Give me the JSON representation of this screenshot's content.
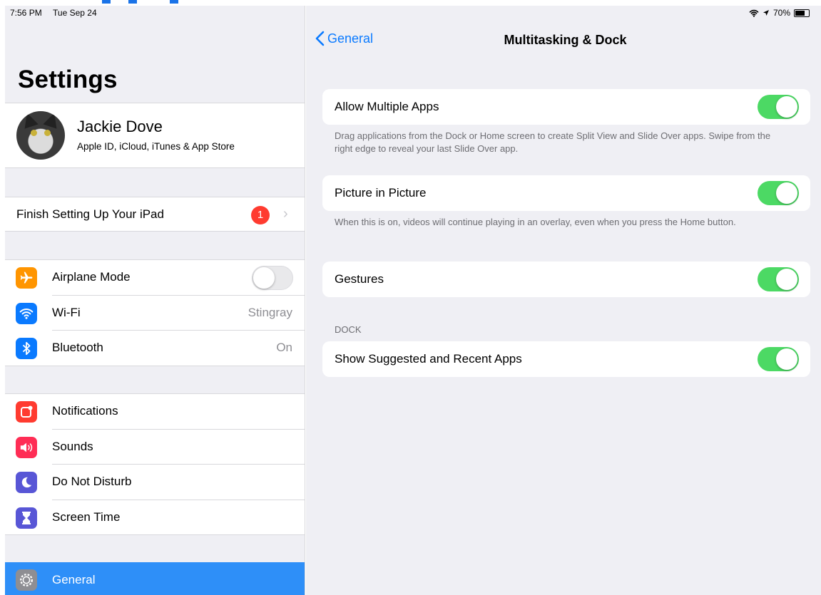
{
  "status": {
    "time": "7:56 PM",
    "date": "Tue Sep 24",
    "battery": "70%"
  },
  "master": {
    "title": "Settings",
    "profile": {
      "name": "Jackie Dove",
      "subtitle": "Apple ID, iCloud, iTunes & App Store"
    },
    "finish": {
      "label": "Finish Setting Up Your iPad",
      "badge": "1"
    },
    "connectivity": [
      {
        "label": "Airplane Mode",
        "icon": "airplane-icon",
        "color": "#ff9500",
        "toggle": false
      },
      {
        "label": "Wi-Fi",
        "icon": "wifi-icon",
        "color": "#0a7aff",
        "value": "Stingray"
      },
      {
        "label": "Bluetooth",
        "icon": "bluetooth-icon",
        "color": "#0a7aff",
        "value": "On"
      }
    ],
    "notifications_group": [
      {
        "label": "Notifications",
        "icon": "notifications-icon",
        "color": "#ff3b30"
      },
      {
        "label": "Sounds",
        "icon": "speaker-icon",
        "color": "#ff2d55"
      },
      {
        "label": "Do Not Disturb",
        "icon": "moon-icon",
        "color": "#5856d6"
      },
      {
        "label": "Screen Time",
        "icon": "hourglass-icon",
        "color": "#5856d6"
      }
    ],
    "general": {
      "label": "General",
      "icon": "gear-icon",
      "selected": true,
      "selection_color": "#2e8ff8"
    }
  },
  "detail": {
    "back_label": "General",
    "title": "Multitasking & Dock",
    "allow_multiple_apps": {
      "label": "Allow Multiple Apps",
      "on": true,
      "footnote": "Drag applications from the Dock or Home screen to create Split View and Slide Over apps. Swipe from the right edge to reveal your last Slide Over app."
    },
    "picture_in_picture": {
      "label": "Picture in Picture",
      "on": true,
      "footnote": "When this is on, videos will continue playing in an overlay, even when you press the Home button."
    },
    "gestures": {
      "label": "Gestures",
      "on": true
    },
    "dock_section": "DOCK",
    "suggested_apps": {
      "label": "Show Suggested and Recent Apps",
      "on": true
    }
  },
  "colors": {
    "switch_on": "#4cd964",
    "accent": "#0a7aff",
    "badge": "#ff3b30"
  }
}
